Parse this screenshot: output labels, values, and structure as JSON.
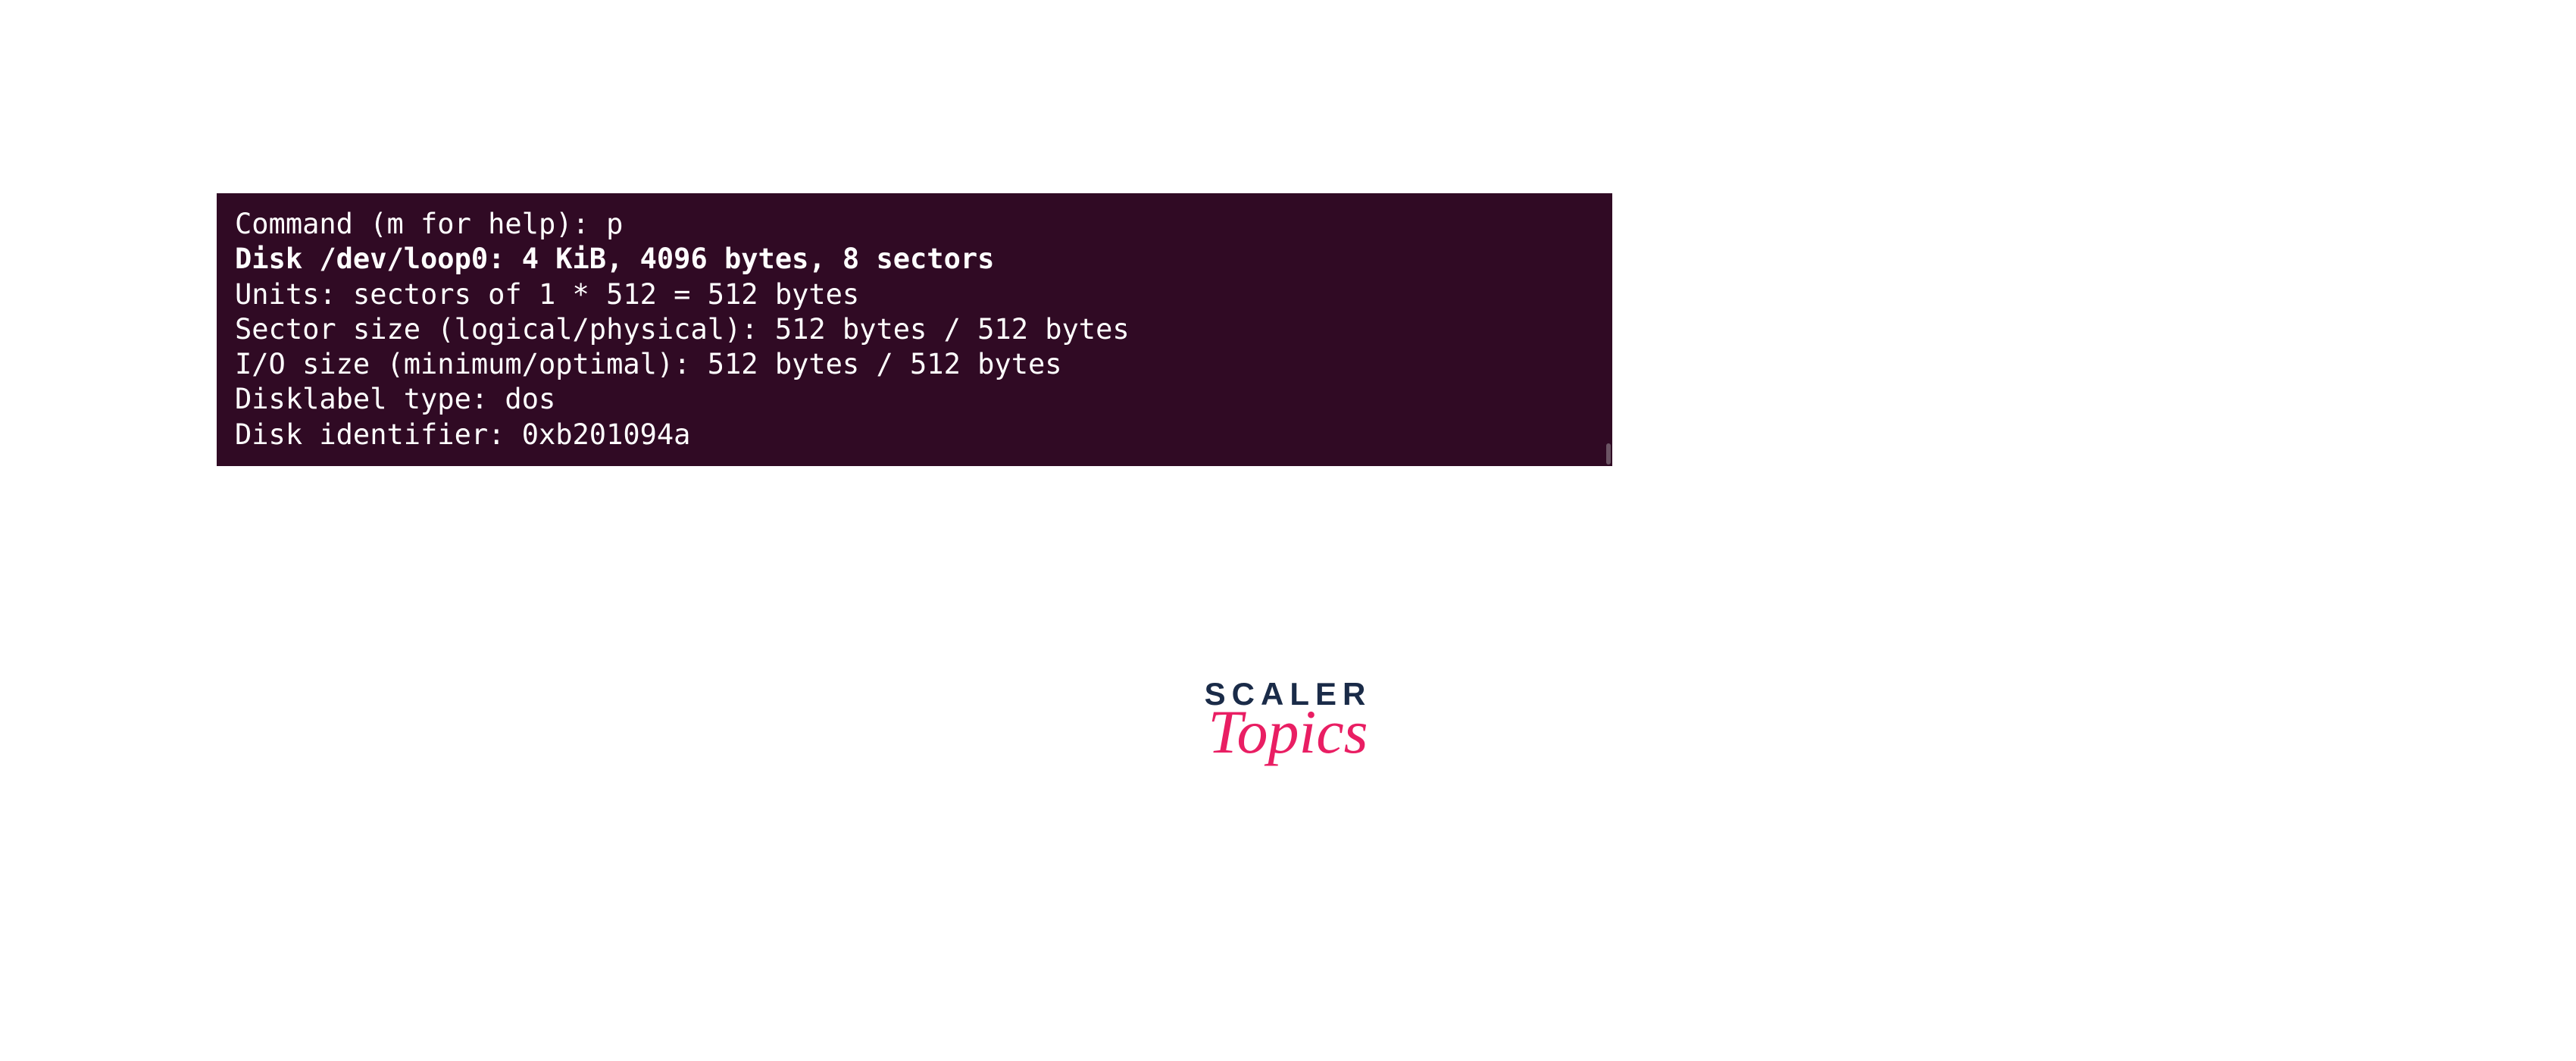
{
  "terminal": {
    "lines": [
      {
        "text": "Command (m for help): p",
        "bold": false
      },
      {
        "text": "Disk /dev/loop0: 4 KiB, 4096 bytes, 8 sectors",
        "bold": true
      },
      {
        "text": "Units: sectors of 1 * 512 = 512 bytes",
        "bold": false
      },
      {
        "text": "Sector size (logical/physical): 512 bytes / 512 bytes",
        "bold": false
      },
      {
        "text": "I/O size (minimum/optimal): 512 bytes / 512 bytes",
        "bold": false
      },
      {
        "text": "Disklabel type: dos",
        "bold": false
      },
      {
        "text": "Disk identifier: 0xb201094a",
        "bold": false
      }
    ]
  },
  "logo": {
    "line1": "SCALER",
    "line2": "Topics"
  }
}
